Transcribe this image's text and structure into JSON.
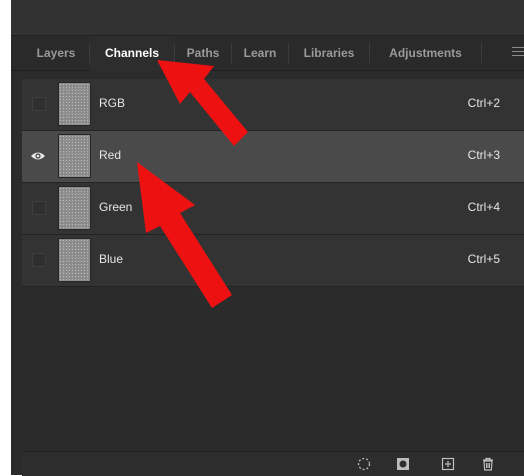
{
  "tabs": [
    {
      "label": "Layers",
      "active": false
    },
    {
      "label": "Channels",
      "active": true
    },
    {
      "label": "Paths",
      "active": false
    },
    {
      "label": "Learn",
      "active": false
    },
    {
      "label": "Libraries",
      "active": false
    },
    {
      "label": "Adjustments",
      "active": false
    }
  ],
  "channels": [
    {
      "label": "RGB",
      "shortcut": "Ctrl+2",
      "visible": false,
      "selected": false
    },
    {
      "label": "Red",
      "shortcut": "Ctrl+3",
      "visible": true,
      "selected": true
    },
    {
      "label": "Green",
      "shortcut": "Ctrl+4",
      "visible": false,
      "selected": false
    },
    {
      "label": "Blue",
      "shortcut": "Ctrl+5",
      "visible": false,
      "selected": false
    }
  ],
  "icons": {
    "panel_menu": "hamburger-menu-icon",
    "visibility": "eye-icon",
    "load_selection": "dotted-circle-icon",
    "save_selection": "mask-icon",
    "new_channel": "plus-square-icon",
    "delete_channel": "trash-icon"
  },
  "colors": {
    "panel_bg": "#2b2b2b",
    "row_bg": "#333333",
    "row_selected_bg": "#4a4a4a",
    "annotation_arrow": "#ee1111"
  }
}
